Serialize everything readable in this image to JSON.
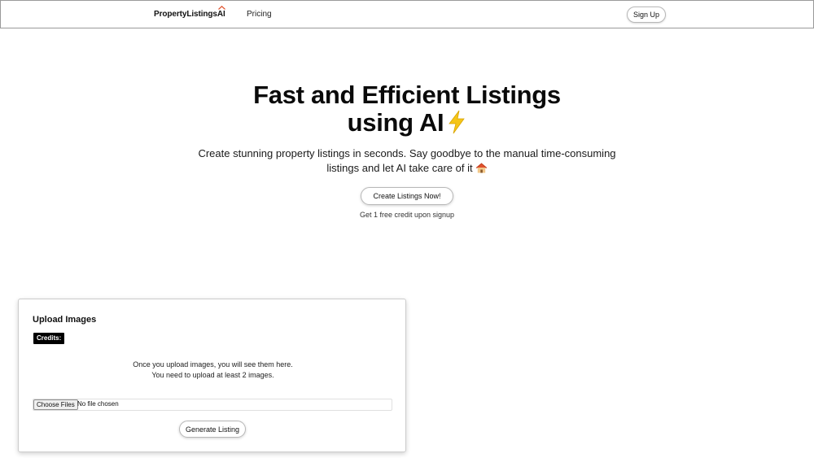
{
  "nav": {
    "logo_main": "PropertyListings",
    "logo_ai": "AI",
    "links": [
      {
        "label": "Pricing"
      }
    ],
    "signup_label": "Sign Up"
  },
  "hero": {
    "title_line1": "Fast and Efficient Listings",
    "title_line2": "using AI",
    "title_icon": "lightning-bolt-emoji",
    "subtitle": "Create stunning property listings in seconds. Say goodbye to the manual time-consuming listings and let AI take care of it",
    "subtitle_icon": "house-emoji",
    "cta_label": "Create Listings Now!",
    "cta_note": "Get 1 free credit upon signup"
  },
  "upload": {
    "title": "Upload Images",
    "credits_label": "Credits:",
    "message_line1": "Once you upload images, you will see them here.",
    "message_line2": "You need to upload at least 2 images.",
    "choose_files_label": "Choose Files",
    "file_status": "No file chosen",
    "generate_label": "Generate Listing"
  },
  "colors": {
    "text": "#111111",
    "badge_bg": "#000000",
    "bolt": "#f5c518",
    "house_roof": "#e0522d"
  }
}
